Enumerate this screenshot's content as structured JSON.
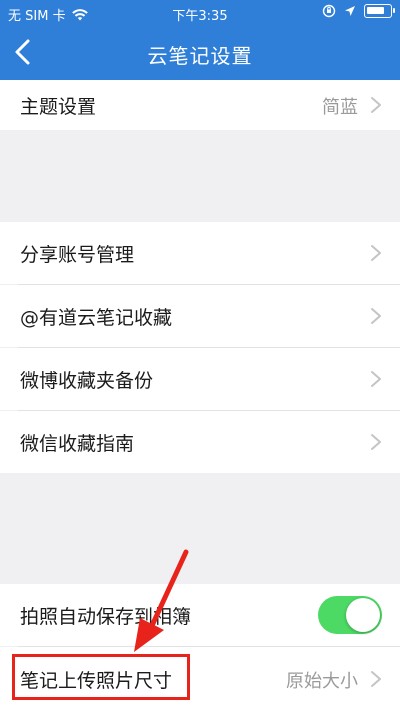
{
  "status_bar": {
    "carrier": "无 SIM 卡",
    "time": "下午3:35",
    "battery_level": 0.85
  },
  "nav": {
    "title": "云笔记设置",
    "back_icon": "chevron-left-icon"
  },
  "sections": {
    "theme": {
      "label": "主题设置",
      "value": "简蓝"
    },
    "accounts": [
      {
        "label": "分享账号管理"
      },
      {
        "label": "@有道云笔记收藏"
      },
      {
        "label": "微博收藏夹备份"
      },
      {
        "label": "微信收藏指南"
      }
    ],
    "photo": {
      "auto_save_label": "拍照自动保存到相簿",
      "auto_save_on": true,
      "upload_size_label": "笔记上传照片尺寸",
      "upload_size_value": "原始大小"
    }
  },
  "colors": {
    "nav_blue": "#2f7fd8",
    "toggle_green": "#4cd964",
    "annotation_red": "#e8231b"
  }
}
